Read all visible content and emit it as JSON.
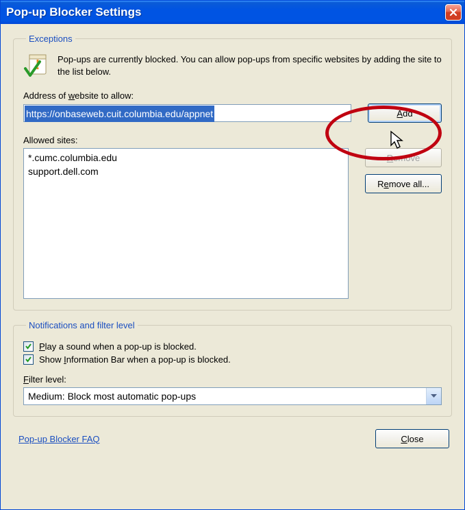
{
  "window": {
    "title": "Pop-up Blocker Settings"
  },
  "exceptions": {
    "legend": "Exceptions",
    "blurb": "Pop-ups are currently blocked.  You can allow pop-ups from specific websites by adding the site to the list below.",
    "address_label_pre": "Address of ",
    "address_label_ul": "w",
    "address_label_post": "ebsite to allow:",
    "address_value": "https://onbaseweb.cuit.columbia.edu/appnet",
    "add_btn_ul": "A",
    "add_btn_post": "dd",
    "allowed_label": "Allowed sites:",
    "allowed_sites": [
      "*.cumc.columbia.edu",
      "support.dell.com"
    ],
    "remove_btn_ul": "R",
    "remove_btn_post": "emove",
    "remove_all_btn_pre": "R",
    "remove_all_btn_ul": "e",
    "remove_all_btn_post": "move all..."
  },
  "notifications": {
    "legend": "Notifications and filter level",
    "play_sound_checked": true,
    "play_sound_ul": "P",
    "play_sound_post": "lay a sound when a pop-up is blocked.",
    "info_bar_checked": true,
    "info_bar_pre": "Show ",
    "info_bar_ul": "I",
    "info_bar_post": "nformation Bar when a pop-up is blocked.",
    "filter_label_ul": "F",
    "filter_label_post": "ilter level:",
    "filter_value": "Medium: Block most automatic pop-ups"
  },
  "footer": {
    "faq": "Pop-up Blocker FAQ",
    "close_ul": "C",
    "close_post": "lose"
  }
}
